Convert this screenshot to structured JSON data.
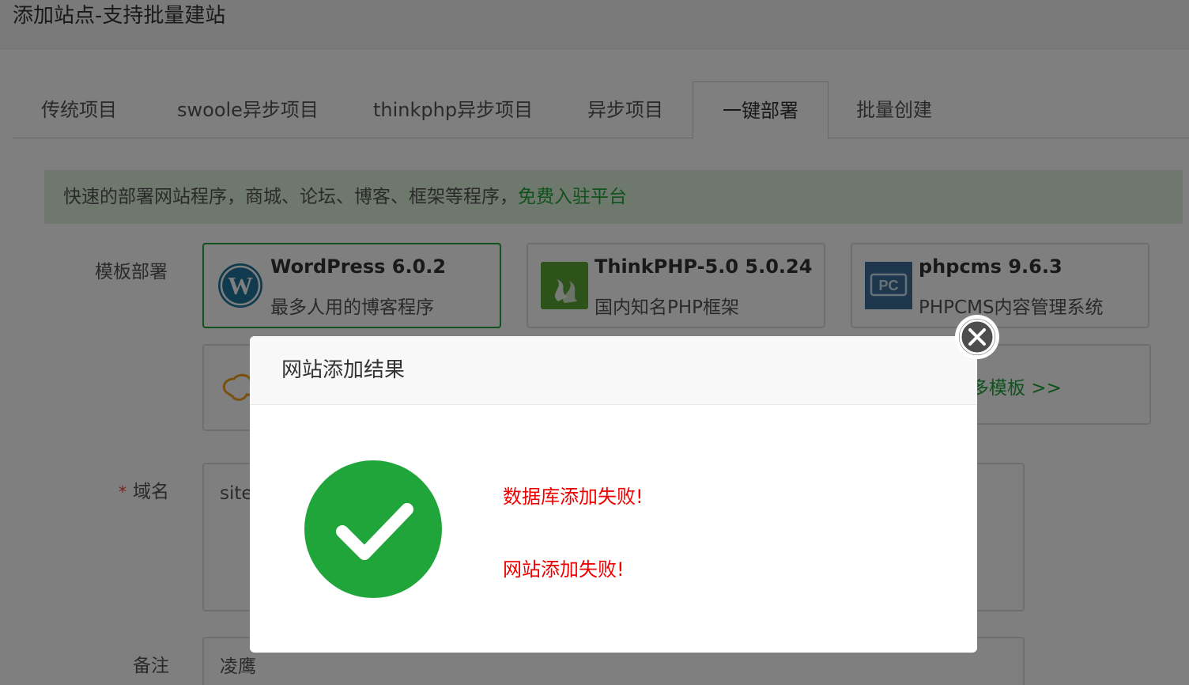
{
  "window": {
    "title": "添加站点-支持批量建站"
  },
  "tabs": [
    {
      "label": "传统项目"
    },
    {
      "label": "swoole异步项目"
    },
    {
      "label": "thinkphp异步项目"
    },
    {
      "label": "异步项目"
    },
    {
      "label": "一键部署"
    },
    {
      "label": "批量创建"
    }
  ],
  "active_tab": "一键部署",
  "notice": {
    "text": "快速的部署网站程序，商城、论坛、博客、框架等程序，",
    "link": "免费入驻平台"
  },
  "form": {
    "template_label": "模板部署",
    "domain_label": "域名",
    "domain_required_mark": "*",
    "domain_value": "site",
    "remark_label": "备注",
    "remark_value": "凌鹰"
  },
  "templates": [
    {
      "name": "WordPress 6.0.2",
      "desc": "最多人用的博客程序",
      "icon": "wordpress-logo",
      "selected": true
    },
    {
      "name": "ThinkPHP-5.0 5.0.24",
      "desc": "国内知名PHP框架",
      "icon": "thinkphp-logo",
      "selected": false
    },
    {
      "name": "phpcms 9.6.3",
      "desc": "PHPCMS内容管理系统",
      "icon": "phpcms-logo",
      "selected": false
    }
  ],
  "more_templates": "多模板 >>",
  "dialog": {
    "title": "网站添加结果",
    "icon": "success-check-icon",
    "messages": [
      "数据库添加失败!",
      "网站添加失败!"
    ],
    "close_icon": "close-icon"
  },
  "colors": {
    "accent": "#20a53a",
    "error": "#e00000",
    "notice_bg": "#dff0d8"
  }
}
